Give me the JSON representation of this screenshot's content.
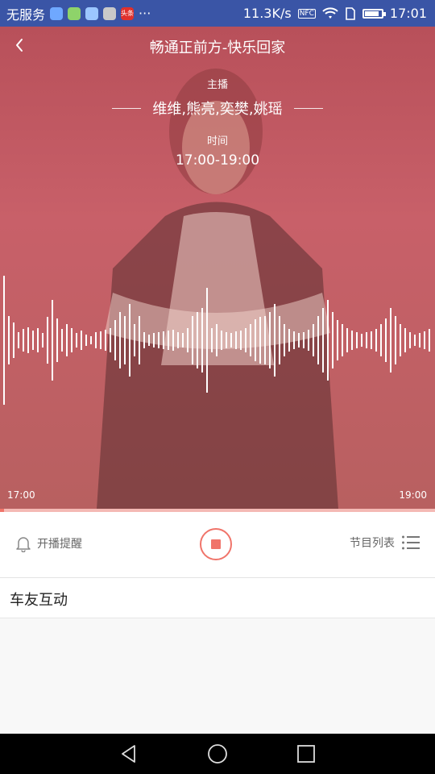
{
  "status_bar": {
    "carrier": "无服务",
    "app_badge_news": "头条",
    "more_dots": "···",
    "net_speed": "11.3K/s",
    "nfc": "NFC",
    "time": "17:01"
  },
  "header": {
    "title": "畅通正前方-快乐回家"
  },
  "program": {
    "host_label": "主播",
    "hosts": "维维,熊亮,奕樊,姚瑶",
    "time_label": "时间",
    "time_range": "17:00-19:00",
    "start_time": "17:00",
    "end_time": "19:00",
    "progress": 0.01
  },
  "controls": {
    "remind_label": "开播提醒",
    "program_list_label": "节目列表"
  },
  "section": {
    "title": "车友互动"
  },
  "colors": {
    "accent": "#f0746a",
    "status_bar": "#3a55a6",
    "hero_overlay": "#c0545e"
  },
  "icons": {
    "back": "chevron-left-icon",
    "remind": "bell-icon",
    "stop": "stop-icon",
    "list": "list-icon",
    "nav_back": "triangle-back-icon",
    "nav_home": "circle-home-icon",
    "nav_recents": "square-recents-icon"
  }
}
